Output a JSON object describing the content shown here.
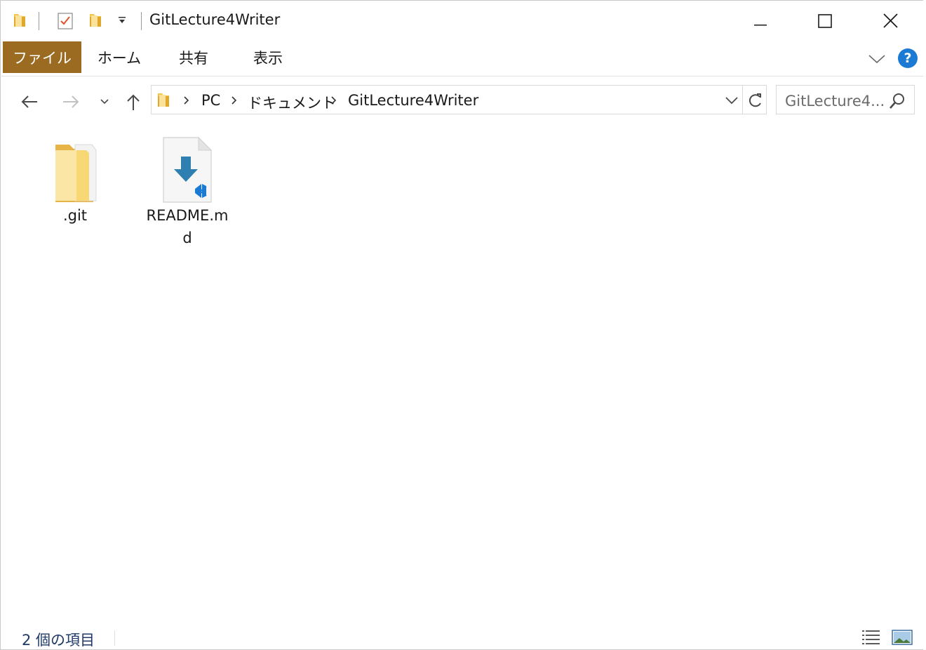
{
  "window": {
    "title": "GitLecture4Writer",
    "controls": {
      "minimize": "minimize",
      "maximize": "maximize",
      "close": "close"
    }
  },
  "quick_access": {
    "icons": [
      "folder-icon",
      "properties-icon",
      "new-folder-icon",
      "customize-dropdown-icon"
    ]
  },
  "ribbon": {
    "tabs": [
      {
        "label": "ファイル",
        "active": true
      },
      {
        "label": "ホーム"
      },
      {
        "label": "共有"
      },
      {
        "label": "表示"
      }
    ],
    "help_label": "?"
  },
  "navigation": {
    "breadcrumbs": [
      "PC",
      "ドキュメント",
      "GitLecture4Writer"
    ],
    "search_placeholder": "GitLecture4..."
  },
  "files": [
    {
      "name": ".git",
      "type": "folder"
    },
    {
      "name_line1": "README.m",
      "name_line2": "d",
      "type": "markdown"
    }
  ],
  "status": {
    "item_count": "2 個の項目"
  },
  "colors": {
    "file_tab": "#9b6b22",
    "folder": "#f3c54a",
    "help_button": "#1a7ad4",
    "vscode_blue": "#1a7ad4",
    "download_arrow": "#2f7fb0",
    "status_text": "#1f3a66"
  }
}
